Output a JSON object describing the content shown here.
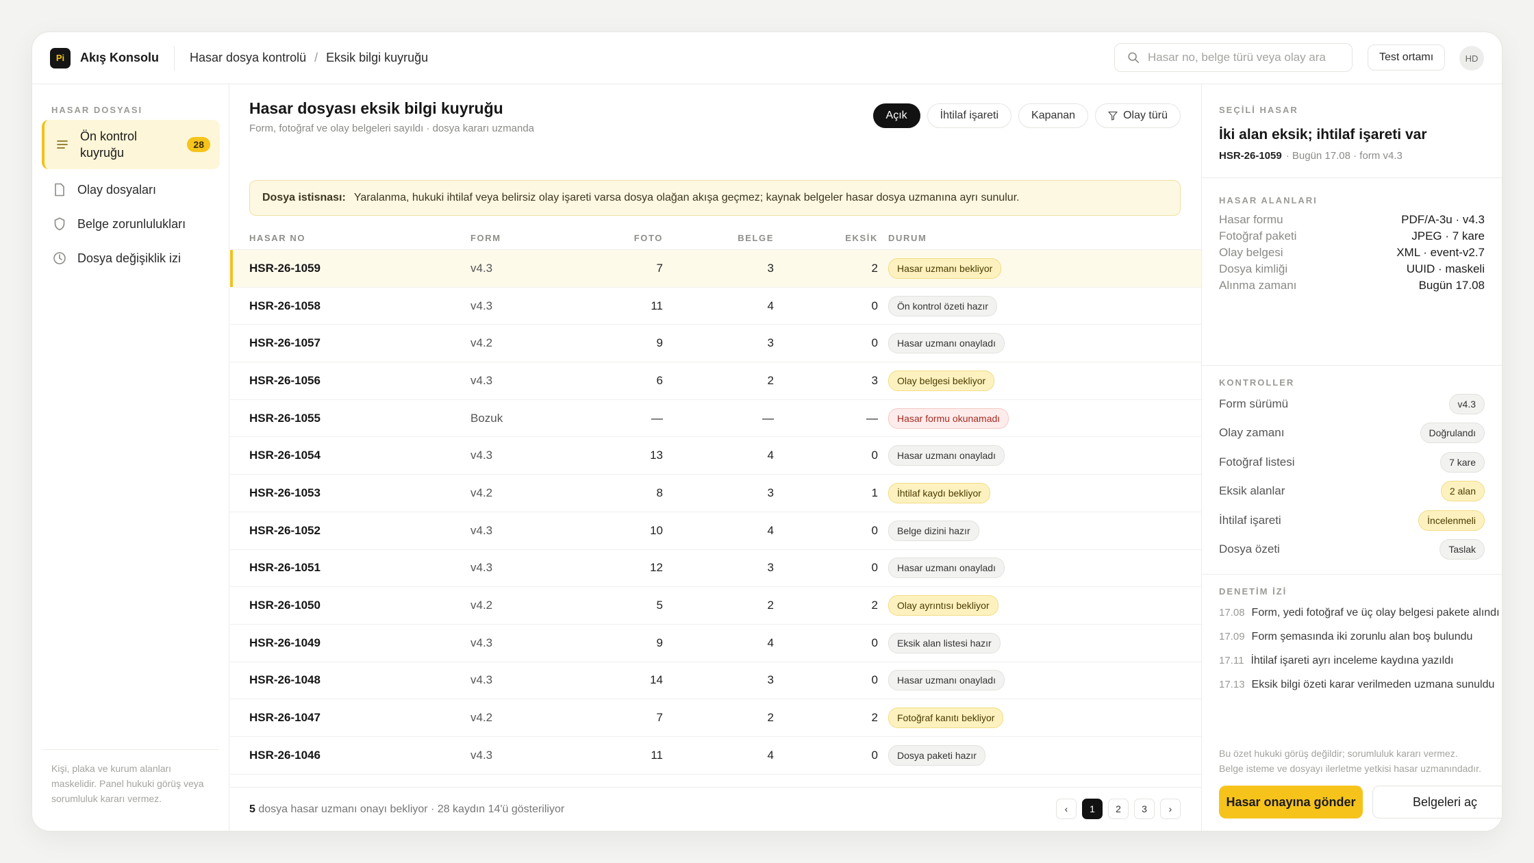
{
  "app": {
    "logo": "Pi",
    "name": "Akış Konsolu"
  },
  "breadcrumb": [
    "Hasar dosya kontrolü",
    "Eksik bilgi kuyruğu"
  ],
  "search": {
    "placeholder": "Hasar no, belge türü veya olay ara",
    "value": ""
  },
  "env_label": "Test ortamı",
  "user_initials": "HD",
  "sidebar": {
    "section": "HASAR DOSYASI",
    "items": [
      {
        "label": "Ön kontrol kuyruğu",
        "badge": "28",
        "icon": "list-icon",
        "active": true
      },
      {
        "label": "Olay dosyaları",
        "icon": "file-icon"
      },
      {
        "label": "Belge zorunlulukları",
        "icon": "shield-icon"
      },
      {
        "label": "Dosya değişiklik izi",
        "icon": "clock-icon"
      }
    ],
    "footer": "Kişi, plaka ve kurum alanları maskelidir. Panel hukuki görüş veya sorumluluk kararı vermez."
  },
  "main": {
    "title": "Hasar dosyası eksik bilgi kuyruğu",
    "subtitle": "Form, fotoğraf ve olay belgeleri sayıldı · dosya kararı uzmanda",
    "filters": [
      "Açık",
      "İhtilaf işareti",
      "Kapanan",
      "Olay türü"
    ],
    "notice_label": "Dosya istisnası:",
    "notice_text": "Yaralanma, hukuki ihtilaf veya belirsiz olay işareti varsa dosya olağan akışa geçmez; kaynak belgeler hasar dosya uzmanına ayrı sunulur.",
    "columns": [
      "HASAR NO",
      "FORM",
      "FOTO",
      "BELGE",
      "EKSİK",
      "DURUM"
    ],
    "rows": [
      {
        "id": "HSR-26-1059",
        "form": "v4.3",
        "foto": "7",
        "belge": "3",
        "eksik": "2",
        "status": "Hasar uzmanı bekliyor",
        "tone": "warn"
      },
      {
        "id": "HSR-26-1058",
        "form": "v4.3",
        "foto": "11",
        "belge": "4",
        "eksik": "0",
        "status": "Ön kontrol özeti hazır",
        "tone": "neutral"
      },
      {
        "id": "HSR-26-1057",
        "form": "v4.2",
        "foto": "9",
        "belge": "3",
        "eksik": "0",
        "status": "Hasar uzmanı onayladı",
        "tone": "neutral"
      },
      {
        "id": "HSR-26-1056",
        "form": "v4.3",
        "foto": "6",
        "belge": "2",
        "eksik": "3",
        "status": "Olay belgesi bekliyor",
        "tone": "warn"
      },
      {
        "id": "HSR-26-1055",
        "form": "Bozuk",
        "foto": "—",
        "belge": "—",
        "eksik": "—",
        "status": "Hasar formu okunamadı",
        "tone": "err"
      },
      {
        "id": "HSR-26-1054",
        "form": "v4.3",
        "foto": "13",
        "belge": "4",
        "eksik": "0",
        "status": "Hasar uzmanı onayladı",
        "tone": "neutral"
      },
      {
        "id": "HSR-26-1053",
        "form": "v4.2",
        "foto": "8",
        "belge": "3",
        "eksik": "1",
        "status": "İhtilaf kaydı bekliyor",
        "tone": "warn"
      },
      {
        "id": "HSR-26-1052",
        "form": "v4.3",
        "foto": "10",
        "belge": "4",
        "eksik": "0",
        "status": "Belge dizini hazır",
        "tone": "neutral"
      },
      {
        "id": "HSR-26-1051",
        "form": "v4.3",
        "foto": "12",
        "belge": "3",
        "eksik": "0",
        "status": "Hasar uzmanı onayladı",
        "tone": "neutral"
      },
      {
        "id": "HSR-26-1050",
        "form": "v4.2",
        "foto": "5",
        "belge": "2",
        "eksik": "2",
        "status": "Olay ayrıntısı bekliyor",
        "tone": "warn"
      },
      {
        "id": "HSR-26-1049",
        "form": "v4.3",
        "foto": "9",
        "belge": "4",
        "eksik": "0",
        "status": "Eksik alan listesi hazır",
        "tone": "neutral"
      },
      {
        "id": "HSR-26-1048",
        "form": "v4.3",
        "foto": "14",
        "belge": "3",
        "eksik": "0",
        "status": "Hasar uzmanı onayladı",
        "tone": "neutral"
      },
      {
        "id": "HSR-26-1047",
        "form": "v4.2",
        "foto": "7",
        "belge": "2",
        "eksik": "2",
        "status": "Fotoğraf kanıtı bekliyor",
        "tone": "warn"
      },
      {
        "id": "HSR-26-1046",
        "form": "v4.3",
        "foto": "11",
        "belge": "4",
        "eksik": "0",
        "status": "Dosya paketi hazır",
        "tone": "neutral"
      }
    ],
    "footer_count": "5",
    "footer_text": " dosya hasar uzmanı onayı bekliyor · 28 kaydın 14'ü gösteriliyor",
    "pages": [
      "‹",
      "1",
      "2",
      "3",
      "›"
    ]
  },
  "panel": {
    "section": "SEÇİLİ HASAR",
    "title": "İki alan eksik; ihtilaf işareti var",
    "id": "HSR-26-1059",
    "meta": "· Bugün 17.08 · form v4.3",
    "fields_title": "HASAR ALANLARI",
    "fields": [
      {
        "k": "Hasar formu",
        "v": "PDF/A-3u · v4.3"
      },
      {
        "k": "Fotoğraf paketi",
        "v": "JPEG · 7 kare"
      },
      {
        "k": "Olay belgesi",
        "v": "XML · event-v2.7"
      },
      {
        "k": "Dosya kimliği",
        "v": "UUID · maskeli"
      },
      {
        "k": "Alınma zamanı",
        "v": "Bugün 17.08"
      }
    ],
    "controls_title": "KONTROLLER",
    "controls": [
      {
        "k": "Form sürümü",
        "v": "v4.3",
        "tone": "neutral"
      },
      {
        "k": "Olay zamanı",
        "v": "Doğrulandı",
        "tone": "neutral"
      },
      {
        "k": "Fotoğraf listesi",
        "v": "7 kare",
        "tone": "neutral"
      },
      {
        "k": "Eksik alanlar",
        "v": "2 alan",
        "tone": "warn"
      },
      {
        "k": "İhtilaf işareti",
        "v": "İncelenmeli",
        "tone": "warn"
      },
      {
        "k": "Dosya özeti",
        "v": "Taslak",
        "tone": "neutral"
      }
    ],
    "audit_title": "DENETİM İZİ",
    "audit": [
      {
        "t": "17.08",
        "text": "Form, yedi fotoğraf ve üç olay belgesi pakete alındı"
      },
      {
        "t": "17.09",
        "text": "Form şemasında iki zorunlu alan boş bulundu"
      },
      {
        "t": "17.11",
        "text": "İhtilaf işareti ayrı inceleme kaydına yazıldı"
      },
      {
        "t": "17.13",
        "text": "Eksik bilgi özeti karar verilmeden uzmana sunuldu"
      }
    ],
    "note": "Bu özet hukuki görüş değildir; sorumluluk kararı vermez. Belge isteme ve dosyayı ilerletme yetkisi hasar uzmanındadır.",
    "primary_btn": "Hasar onayına gönder",
    "secondary_btn": "Belgeleri aç"
  },
  "colors": {
    "accent": "#f6c31b",
    "dark": "#121212",
    "warn_bg": "#fdf2bf",
    "err_text": "#a32b21"
  }
}
